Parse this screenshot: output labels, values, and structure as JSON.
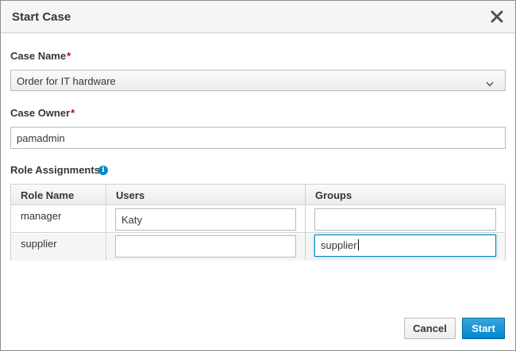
{
  "dialog": {
    "title": "Start Case",
    "close_icon": "close-icon"
  },
  "case_name": {
    "label": "Case Name",
    "required_mark": "*",
    "selected": "Order for IT hardware"
  },
  "case_owner": {
    "label": "Case Owner",
    "required_mark": "*",
    "value": "pamadmin"
  },
  "role_assignments": {
    "label": "Role Assignments",
    "info_icon": "info-icon",
    "columns": [
      "Role Name",
      "Users",
      "Groups"
    ],
    "rows": [
      {
        "role": "manager",
        "users": "Katy",
        "groups": ""
      },
      {
        "role": "supplier",
        "users": "",
        "groups": "supplier"
      }
    ]
  },
  "footer": {
    "cancel_label": "Cancel",
    "start_label": "Start"
  },
  "colors": {
    "primary": "#0088ce",
    "required": "#cc0000"
  }
}
